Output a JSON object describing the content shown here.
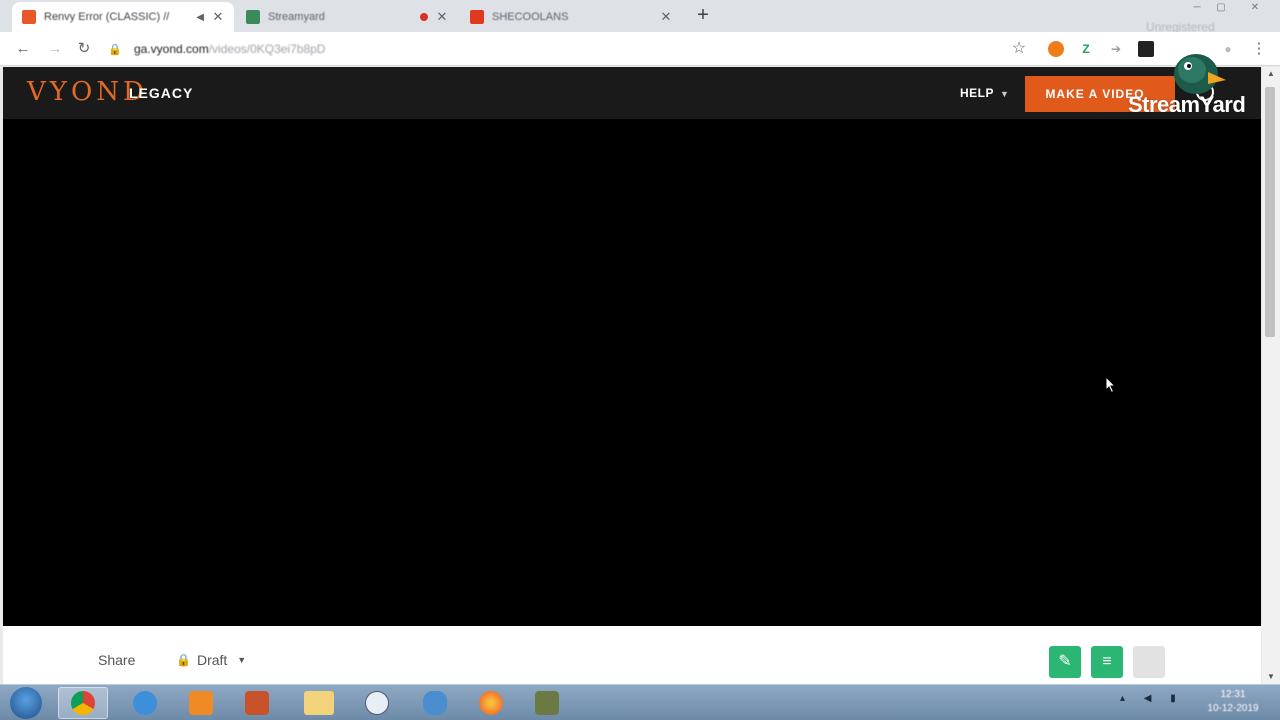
{
  "browser": {
    "tabs": [
      {
        "title": "Renvy Error (CLASSIC) //",
        "favicon_color": "#e8572a",
        "active": true
      },
      {
        "title": "Streamyard",
        "favicon_color": "#3b8a5a",
        "active": false,
        "recording": true
      },
      {
        "title": "SHECOOLANS",
        "favicon_color": "#e03a1e",
        "active": false
      }
    ],
    "new_tab": "+",
    "ghost_overlay_text": "Unregistered",
    "back": "←",
    "forward": "→",
    "reload": "↻",
    "url_host": "ga.vyond.com",
    "url_path": "/videos/0KQ3ei7b8pD",
    "bookmark_star": "☆",
    "menu": "⋮"
  },
  "app": {
    "logo": "VYOND",
    "legacy_label": "LEGACY",
    "help_label": "HELP",
    "make_video_label": "MAKE A VIDEO",
    "share_label": "Share",
    "draft_label": "Draft",
    "edit_button_color": "#2bb673",
    "list_button_color": "#2bb673",
    "accent_color": "#e05a1c"
  },
  "overlay": {
    "streamyard_text": "StreamYard"
  },
  "taskbar": {
    "clock_time": "12:31",
    "clock_date": "10-12-2019"
  }
}
